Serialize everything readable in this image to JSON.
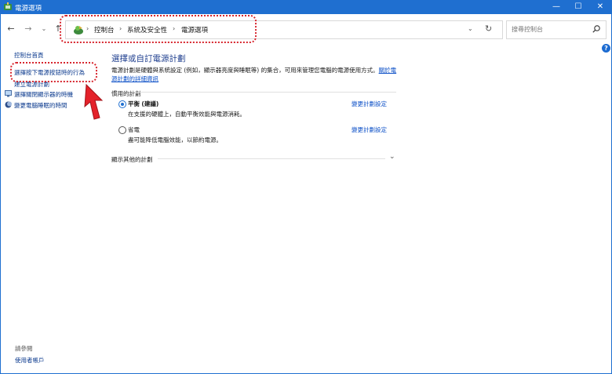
{
  "window": {
    "title": "電源選項",
    "minimize_label": "—",
    "maximize_label": "☐",
    "close_label": "✕"
  },
  "nav": {
    "back": "←",
    "forward": "→",
    "down": "⌄",
    "up": "↑"
  },
  "address": {
    "sep": "›",
    "crumbs": [
      "控制台",
      "系統及安全性",
      "電源選項"
    ],
    "dropdown": "⌄",
    "refresh": "↻"
  },
  "search": {
    "placeholder": "搜尋控制台"
  },
  "help": "?",
  "sidebar": {
    "home": "控制台首頁",
    "items": [
      "選擇按下電源按鈕時的行為",
      "建立電源計劃",
      "選擇關閉顯示器的時機",
      "變更電腦睡眠的時間"
    ]
  },
  "main": {
    "title": "選擇或自訂電源計劃",
    "description": "電源計劃是硬體與系統設定 (例如，顯示器亮度與睡眠等) 的集合，可用來管理您電腦的電源使用方式。",
    "description_link_1": "關於電",
    "description_link_2": "源計劃的詳細資訊",
    "section_label": "慣用的計劃",
    "plans": [
      {
        "name": "平衡",
        "tag": "(建議)",
        "desc": "在支援的硬體上，自動平衡效能與電源消耗。",
        "link": "變更計劃設定",
        "selected": true
      },
      {
        "name": "省電",
        "tag": "",
        "desc": "盡可能降低電腦效能，以節約電源。",
        "link": "變更計劃設定",
        "selected": false
      }
    ],
    "more_plans": "顯示其他的計劃",
    "more_chevron": "⌄"
  },
  "see_also": {
    "label": "請參閱",
    "items": [
      "使用者帳戶"
    ]
  },
  "colors": {
    "titlebar": "#1f6fd0",
    "highlight": "#d7262e",
    "link": "#0b4fc7",
    "heading": "#1f3f8f"
  }
}
